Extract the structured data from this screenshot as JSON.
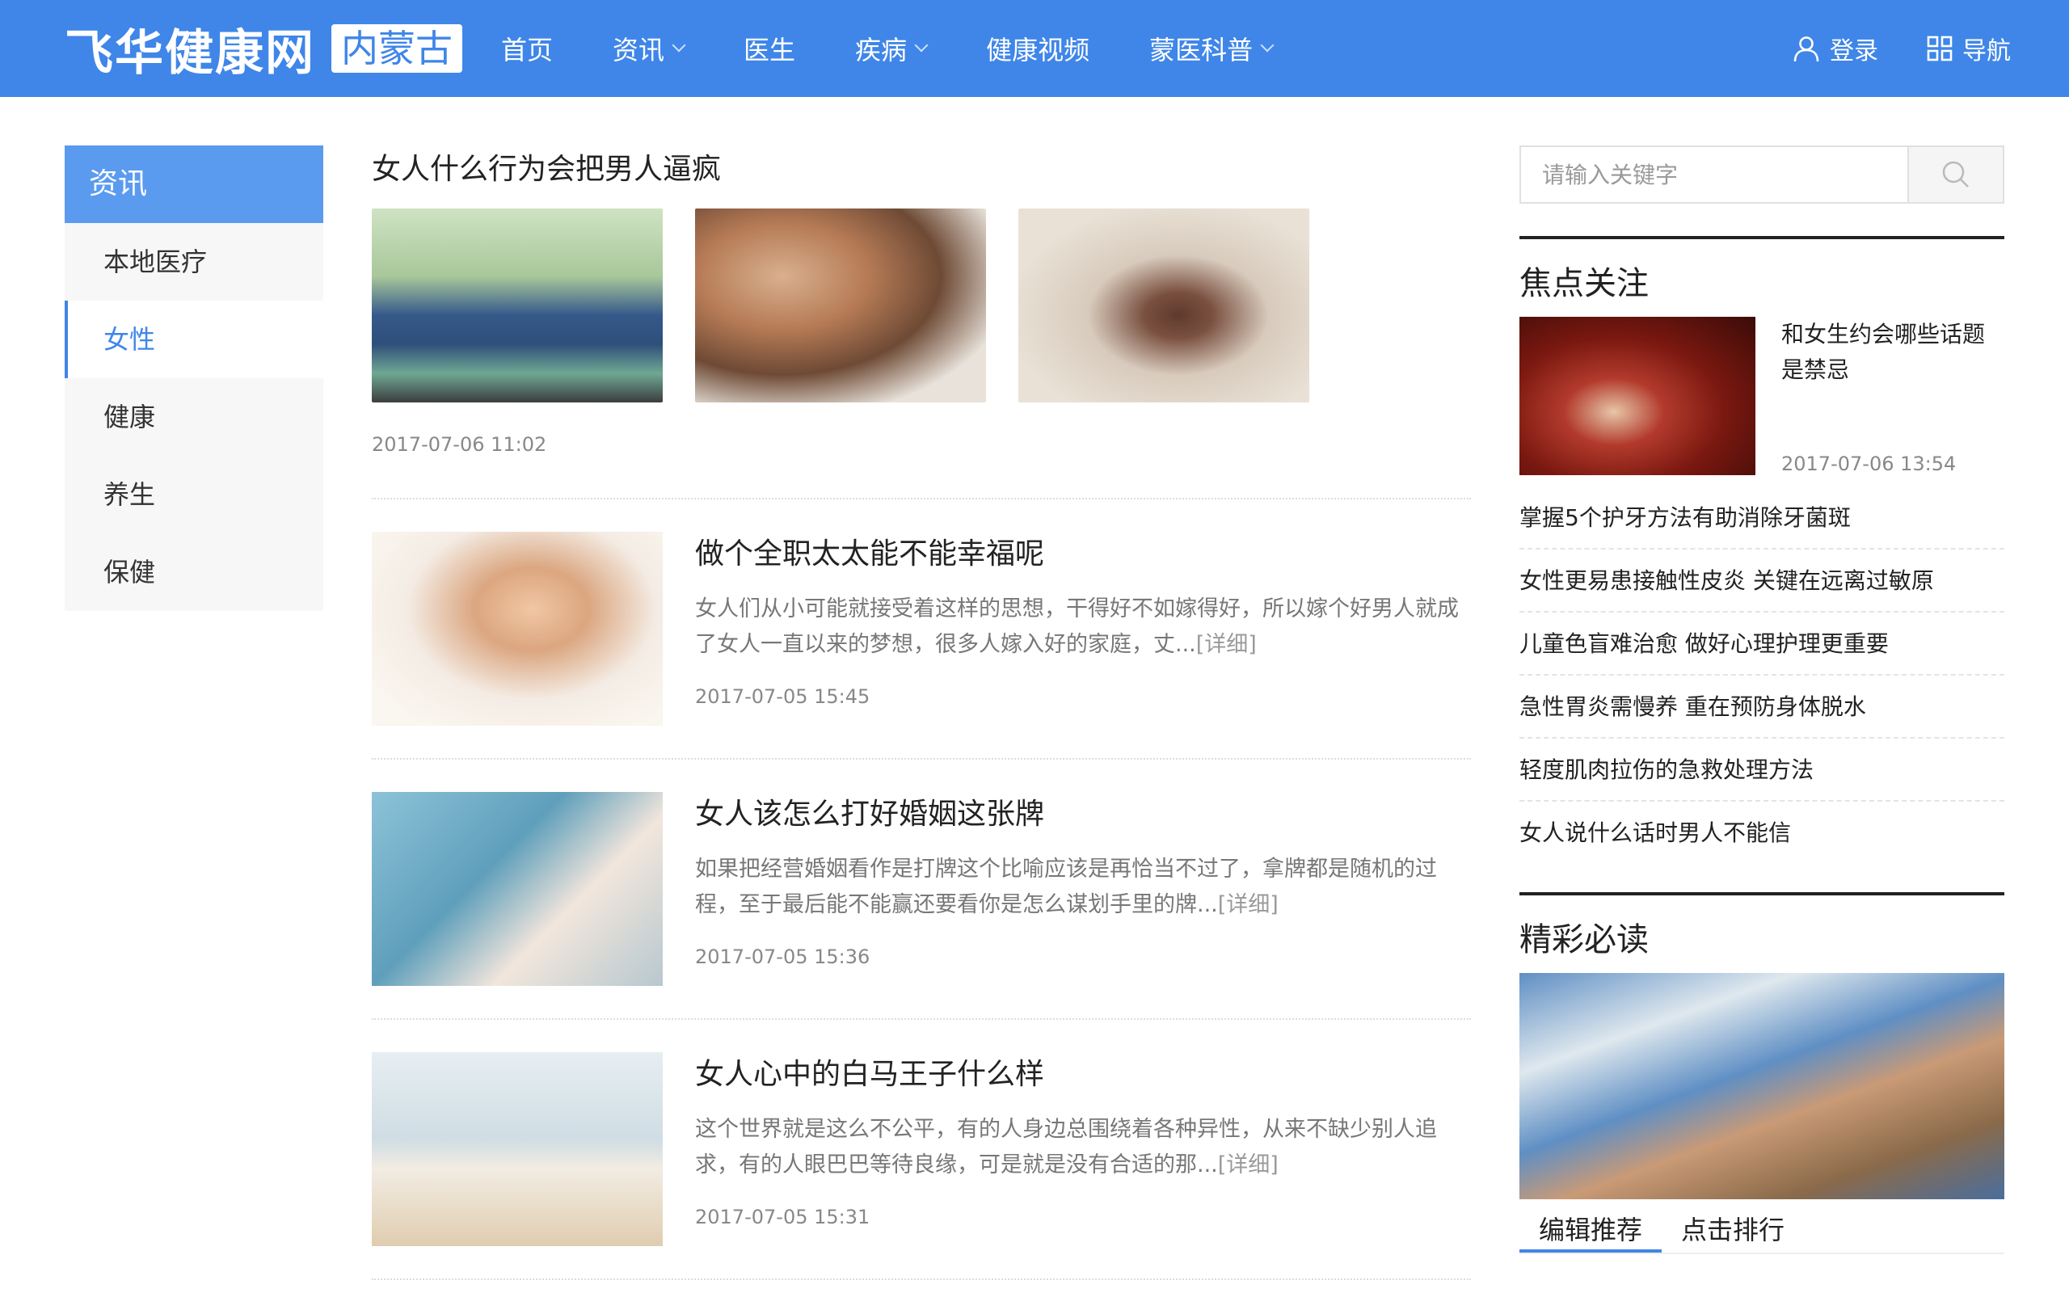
{
  "header": {
    "logo_text": "飞华健康网",
    "region": "内蒙古",
    "nav": [
      {
        "label": "首页",
        "dropdown": false
      },
      {
        "label": "资讯",
        "dropdown": true
      },
      {
        "label": "医生",
        "dropdown": false
      },
      {
        "label": "疾病",
        "dropdown": true
      },
      {
        "label": "健康视频",
        "dropdown": false
      },
      {
        "label": "蒙医科普",
        "dropdown": true
      }
    ],
    "login_label": "登录",
    "guide_label": "导航"
  },
  "sidebar": {
    "title": "资讯",
    "items": [
      {
        "label": "本地医疗",
        "active": false
      },
      {
        "label": "女性",
        "active": true
      },
      {
        "label": "健康",
        "active": false
      },
      {
        "label": "养生",
        "active": false
      },
      {
        "label": "保健",
        "active": false
      }
    ]
  },
  "featured": {
    "title": "女人什么行为会把男人逼疯",
    "date": "2017-07-06 11:02",
    "images": [
      "couple-kissing-photo",
      "couple-laughing-photo",
      "woman-on-beach-photo"
    ]
  },
  "articles": [
    {
      "title": "做个全职太太能不能幸福呢",
      "summary": "女人们从小可能就接受着这样的思想，干得好不如嫁得好，所以嫁个好男人就成了女人一直以来的梦想，很多人嫁入好的家庭，丈...",
      "more": "[详细]",
      "date": "2017-07-05 15:45",
      "image": "mother-and-baby-photo"
    },
    {
      "title": "女人该怎么打好婚姻这张牌",
      "summary": "如果把经营婚姻看作是打牌这个比喻应该是再恰当不过了，拿牌都是随机的过程，至于最后能不能赢还要看你是怎么谋划手里的牌...",
      "more": "[详细]",
      "date": "2017-07-05 15:36",
      "image": "couple-at-sea-photo"
    },
    {
      "title": "女人心中的白马王子什么样",
      "summary": "这个世界就是这么不公平，有的人身边总围绕着各种异性，从来不缺少别人追求，有的人眼巴巴等待良缘，可是就是没有合适的那...",
      "more": "[详细]",
      "date": "2017-07-05 15:31",
      "image": "couple-on-beach-photo"
    }
  ],
  "right": {
    "search_placeholder": "请输入关键字",
    "focus": {
      "heading": "焦点关注",
      "top": {
        "title": "和女生约会哪些话题是禁忌",
        "date": "2017-07-06 13:54",
        "image": "dinner-date-photo"
      },
      "list": [
        "掌握5个护牙方法有助消除牙菌斑",
        "女性更易患接触性皮炎 关键在远离过敏原",
        "儿童色盲难治愈 做好心理护理更重要",
        "急性胃炎需慢养 重在预防身体脱水",
        "轻度肌肉拉伤的急救处理方法",
        "女人说什么话时男人不能信"
      ]
    },
    "must_read": {
      "heading": "精彩必读",
      "image": "sick-child-with-teddy-photo",
      "tabs": [
        {
          "label": "编辑推荐",
          "active": true
        },
        {
          "label": "点击排行",
          "active": false
        }
      ]
    }
  },
  "colors": {
    "brand": "#3f86e8",
    "sidebar_title": "#5a9bf0"
  }
}
